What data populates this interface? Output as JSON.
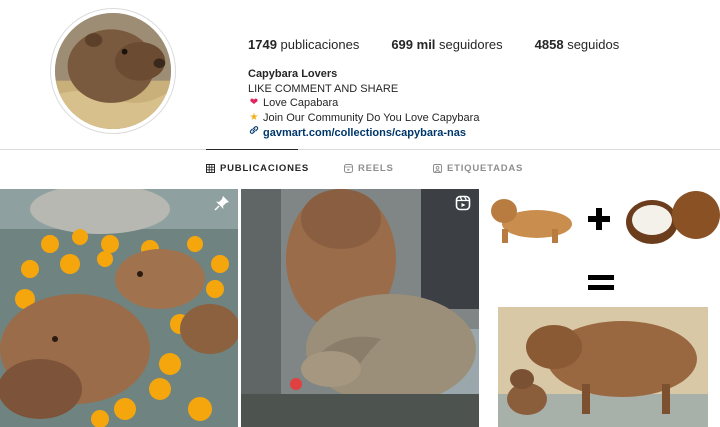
{
  "profile": {
    "avatar_alt": "capybara profile photo",
    "stats": [
      {
        "count": "1749",
        "label": "publicaciones"
      },
      {
        "count": "699 mil",
        "label": "seguidores"
      },
      {
        "count": "4858",
        "label": "seguidos"
      }
    ],
    "name": "Capybara Lovers",
    "bio_line_1": "LIKE COMMENT AND SHARE",
    "bio_line_2": "Love Capabara",
    "bio_line_3": "Join Our Community Do You Love Capybara",
    "link": "gavmart.com/collections/capybara-nas",
    "icons": {
      "heart": "heart-icon",
      "star": "star-icon",
      "link": "link-icon"
    }
  },
  "tabs": [
    {
      "label": "PUBLICACIONES",
      "icon": "grid-icon",
      "active": true
    },
    {
      "label": "REELS",
      "icon": "reels-icon",
      "active": false
    },
    {
      "label": "ETIQUETADAS",
      "icon": "tagged-icon",
      "active": false
    }
  ],
  "posts": [
    {
      "badge": "pinned-icon",
      "subject": "capybaras bathing with oranges"
    },
    {
      "badge": "reel-icon",
      "subject": "capybara with tortoise"
    },
    {
      "badge": "",
      "subject": "dog plus coconut equals capybara"
    }
  ],
  "colors": {
    "link": "#00376b",
    "text": "#262626",
    "muted": "#8e8e8e",
    "border": "#dbdbdb"
  }
}
